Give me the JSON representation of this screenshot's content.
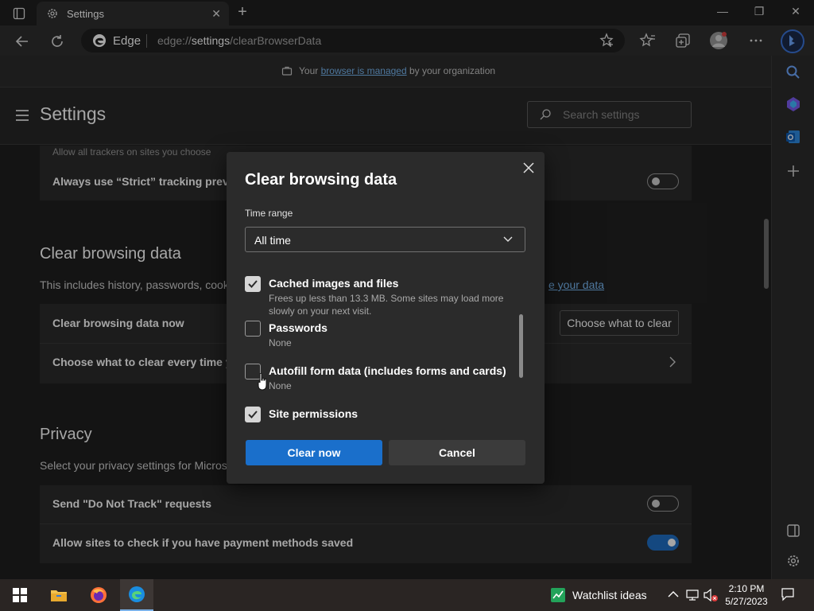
{
  "tab": {
    "title": "Settings",
    "close": "✕"
  },
  "newtab": "+",
  "window": {
    "minimize": "—",
    "restore": "❐",
    "close": "✕"
  },
  "omnibox": {
    "site": "Edge",
    "url_prefix": "edge://",
    "url_host": "settings",
    "url_path": "/clearBrowserData"
  },
  "managed": {
    "prefix": "Your",
    "link": "browser is managed",
    "suffix": "by your organization"
  },
  "settings": {
    "title": "Settings",
    "search_placeholder": "Search settings"
  },
  "tracking": {
    "partial_sub": "Allow all trackers on sites you choose",
    "strict_label": "Always use “Strict” tracking preven",
    "strict_on": false
  },
  "clear_section": {
    "title": "Clear browsing data",
    "desc": "This includes history, passwords, cooki",
    "desc_link": "e your data",
    "row1": "Clear browsing data now",
    "row1_button": "Choose what to clear",
    "row2": "Choose what to clear every time yo"
  },
  "privacy": {
    "title": "Privacy",
    "desc": "Select your privacy settings for Micros",
    "dnt_label": "Send \"Do Not Track\" requests",
    "dnt_on": false,
    "payment_label": "Allow sites to check if you have payment methods saved",
    "payment_on": true
  },
  "dialog": {
    "title": "Clear browsing data",
    "time_range_label": "Time range",
    "time_range_value": "All time",
    "options": [
      {
        "label": "Cached images and files",
        "sub": "Frees up less than 13.3 MB. Some sites may load more slowly on your next visit.",
        "checked": true
      },
      {
        "label": "Passwords",
        "sub": "None",
        "checked": false
      },
      {
        "label": "Autofill form data (includes forms and cards)",
        "sub": "None",
        "checked": false
      },
      {
        "label": "Site permissions",
        "sub": "",
        "checked": true
      }
    ],
    "clear_button": "Clear now",
    "cancel_button": "Cancel"
  },
  "taskbar": {
    "widget": "Watchlist ideas",
    "time": "2:10 PM",
    "date": "5/27/2023"
  },
  "colors": {
    "accent": "#1a6fcb",
    "link": "#79b8f3",
    "background": "#202020",
    "card": "#2b2b2b"
  }
}
